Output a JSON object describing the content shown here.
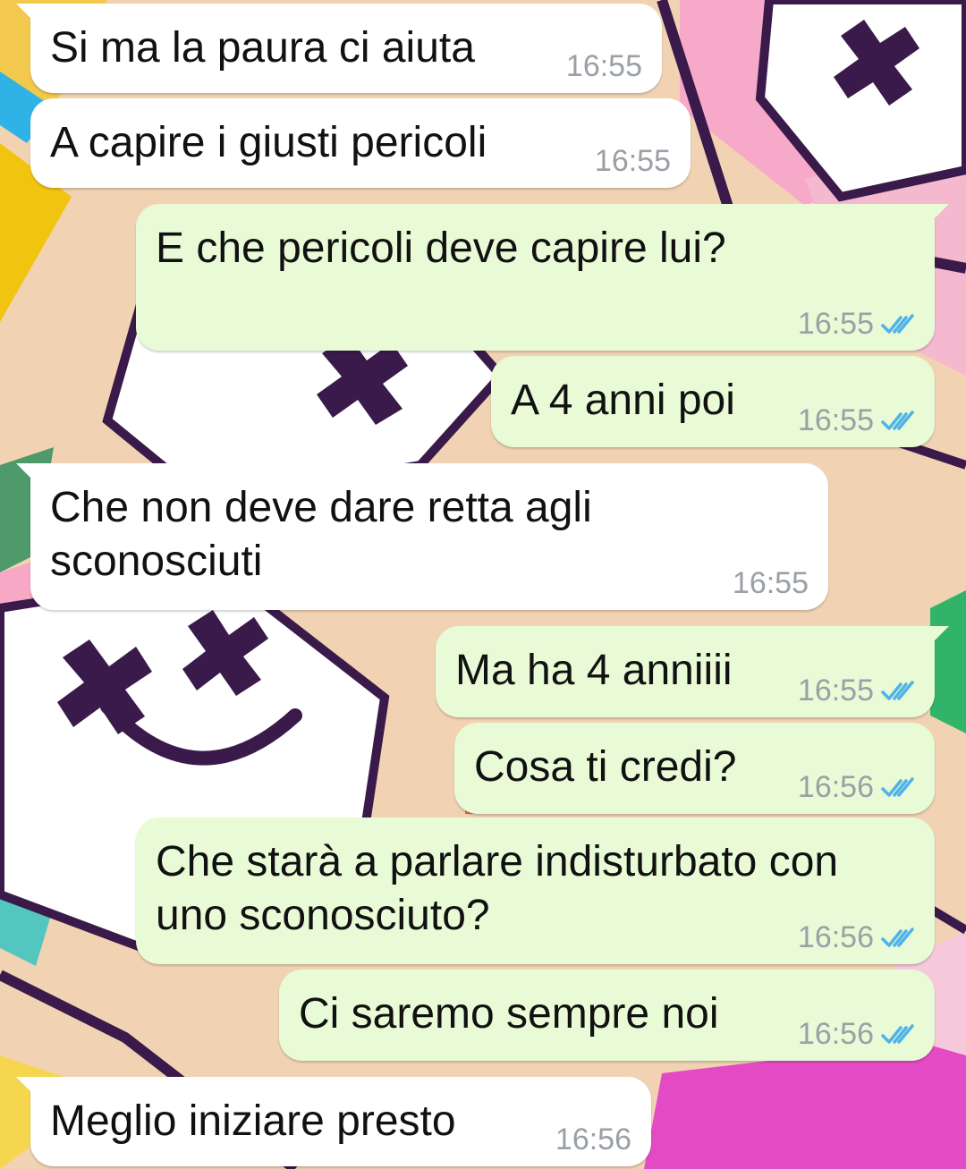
{
  "colors": {
    "incoming_bubble": "#ffffff",
    "outgoing_bubble": "#e8fbd6",
    "timestamp": "#9aa0a6",
    "read_ticks": "#4fb3e8"
  },
  "messages": [
    {
      "direction": "in",
      "text": "Si ma la paura ci aiuta",
      "time": "16:55"
    },
    {
      "direction": "in",
      "text": "A capire i giusti pericoli",
      "time": "16:55"
    },
    {
      "direction": "out",
      "text": "E che pericoli deve capire lui?",
      "time": "16:55",
      "status_icon": "double-check-read-icon"
    },
    {
      "direction": "out",
      "text": "A 4 anni poi",
      "time": "16:55",
      "status_icon": "double-check-read-icon"
    },
    {
      "direction": "in",
      "lines": [
        "Che non deve dare retta agli",
        "sconosciuti"
      ],
      "time": "16:55"
    },
    {
      "direction": "out",
      "text": "Ma ha 4 anniiii",
      "time": "16:55",
      "status_icon": "double-check-read-icon"
    },
    {
      "direction": "out",
      "text": "Cosa ti credi?",
      "time": "16:56",
      "status_icon": "double-check-read-icon"
    },
    {
      "direction": "out",
      "lines": [
        "Che starà a parlare indisturbato con",
        "uno sconosciuto?"
      ],
      "time": "16:56",
      "status_icon": "double-check-read-icon"
    },
    {
      "direction": "out",
      "text": "Ci saremo sempre noi",
      "time": "16:56",
      "status_icon": "double-check-read-icon"
    },
    {
      "direction": "in",
      "text": "Meglio iniziare presto",
      "time": "16:56"
    }
  ]
}
